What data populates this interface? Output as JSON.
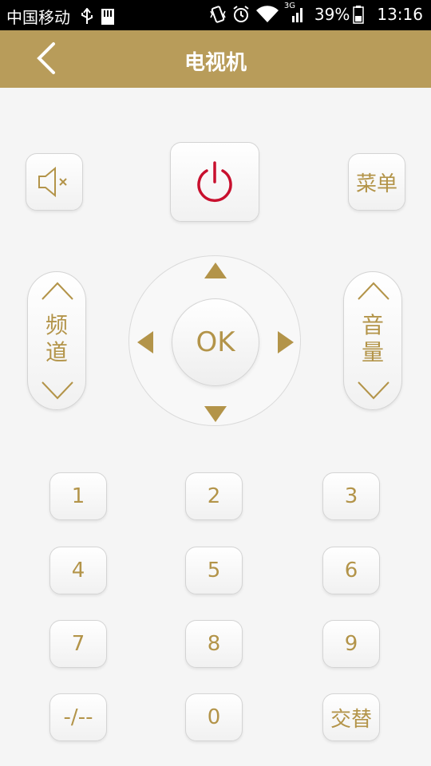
{
  "status_bar": {
    "carrier": "中国移动",
    "network_badge": "3G",
    "battery": "39%",
    "time": "13:16"
  },
  "title_bar": {
    "title": "电视机"
  },
  "remote": {
    "menu_label": "菜单",
    "channel_label": [
      "频",
      "道"
    ],
    "volume_label": [
      "音",
      "量"
    ],
    "ok_label": "OK",
    "keys": {
      "k1": "1",
      "k2": "2",
      "k3": "3",
      "k4": "4",
      "k5": "5",
      "k6": "6",
      "k7": "7",
      "k8": "8",
      "k9": "9",
      "digits": "-/--",
      "k0": "0",
      "swap": "交替"
    }
  },
  "colors": {
    "accent": "#b89c5a",
    "key_text": "#b39449",
    "power": "#c8102e"
  }
}
